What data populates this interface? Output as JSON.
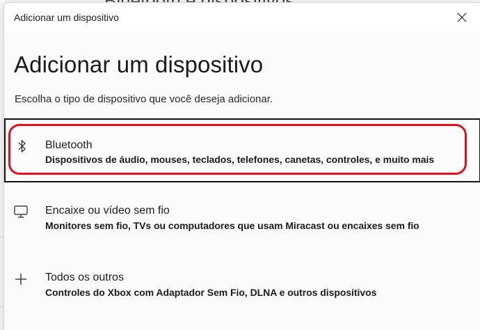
{
  "background": {
    "title": "Bluetooth e dispositivos"
  },
  "window": {
    "title": "Adicionar um dispositivo",
    "close_icon": "close-icon"
  },
  "page": {
    "heading": "Adicionar um dispositivo",
    "subtitle": "Escolha o tipo de dispositivo que você deseja adicionar."
  },
  "options": [
    {
      "icon": "bluetooth-icon",
      "title": "Bluetooth",
      "description": "Dispositivos de áudio, mouses, teclados, telefones, canetas, controles, e muito mais",
      "highlighted": true
    },
    {
      "icon": "monitor-icon",
      "title": "Encaixe ou vídeo sem fio",
      "description": "Monitores sem fio, TVs ou computadores que usam Miracast ou encaixes sem fio"
    },
    {
      "icon": "plus-icon",
      "title": "Todos os outros",
      "description": "Controles do Xbox com Adaptador Sem Fio, DLNA e outros dispositivos"
    }
  ],
  "colors": {
    "highlight": "#e2101e",
    "selection_border": "#111111"
  }
}
